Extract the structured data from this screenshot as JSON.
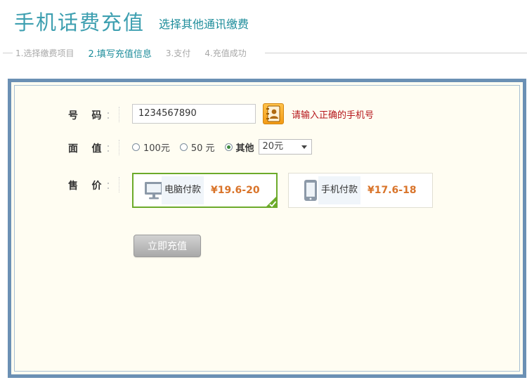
{
  "header": {
    "title": "手机话费充值",
    "subtitle": "选择其他通讯缴费"
  },
  "steps": [
    {
      "label": "1.选择缴费项目",
      "active": false
    },
    {
      "label": "2.填写充值信息",
      "active": true
    },
    {
      "label": "3.支付",
      "active": false
    },
    {
      "label": "4.充值成功",
      "active": false
    }
  ],
  "form": {
    "phone": {
      "label": "号    码",
      "sep": "：",
      "value": "1234567890",
      "hint": "请输入正确的手机号",
      "contact_icon": "contacts-book-icon"
    },
    "denomination": {
      "label": "面    值",
      "sep": "：",
      "options": [
        "100元",
        "50 元",
        "其他"
      ],
      "selected_index": 2,
      "other_select": "20元"
    },
    "price": {
      "label": "售    价",
      "sep": "：",
      "options": [
        {
          "label": "电脑付款",
          "price": "¥19.6-20",
          "icon": "monitor-icon",
          "selected": true
        },
        {
          "label": "手机付款",
          "price": "¥17.6-18",
          "icon": "phone-icon",
          "selected": false
        }
      ]
    },
    "submit_label": "立即充值"
  },
  "colors": {
    "title": "#3d9fb0",
    "frame": "#6b90b4",
    "panel_bg": "#fffdf2",
    "hint": "#b5161b",
    "price": "#d9742a",
    "selected_border": "#6caa2a"
  }
}
